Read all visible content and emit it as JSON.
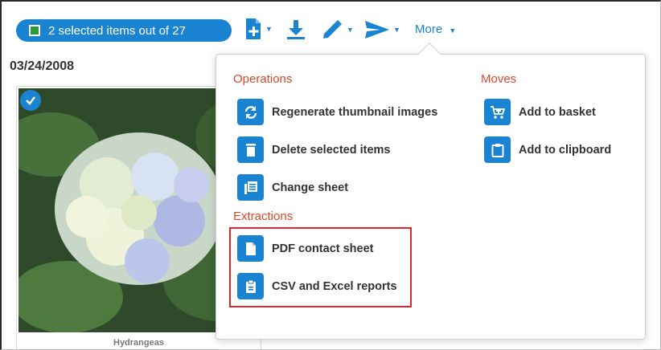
{
  "toolbar": {
    "selection_label": "2 selected items out of 27",
    "more_label": "More",
    "icons": [
      "add-document-icon",
      "download-icon",
      "pencil-icon",
      "send-icon"
    ]
  },
  "content": {
    "date": "03/24/2008",
    "card": {
      "caption": "Hydrangeas",
      "selected": true
    }
  },
  "menu": {
    "operations": {
      "title": "Operations",
      "items": [
        {
          "label": "Regenerate thumbnail images",
          "icon": "refresh-icon"
        },
        {
          "label": "Delete selected items",
          "icon": "trash-icon"
        },
        {
          "label": "Change sheet",
          "icon": "sheet-icon"
        }
      ]
    },
    "moves": {
      "title": "Moves",
      "items": [
        {
          "label": "Add to basket",
          "icon": "basket-icon"
        },
        {
          "label": "Add to clipboard",
          "icon": "clipboard-icon"
        }
      ]
    },
    "extractions": {
      "title": "Extractions",
      "items": [
        {
          "label": "PDF contact sheet",
          "icon": "pdf-document-icon"
        },
        {
          "label": "CSV and Excel reports",
          "icon": "report-icon"
        }
      ]
    }
  },
  "colors": {
    "accent": "#1a84d3",
    "section": "#d9492b",
    "highlight": "#e0262c"
  }
}
